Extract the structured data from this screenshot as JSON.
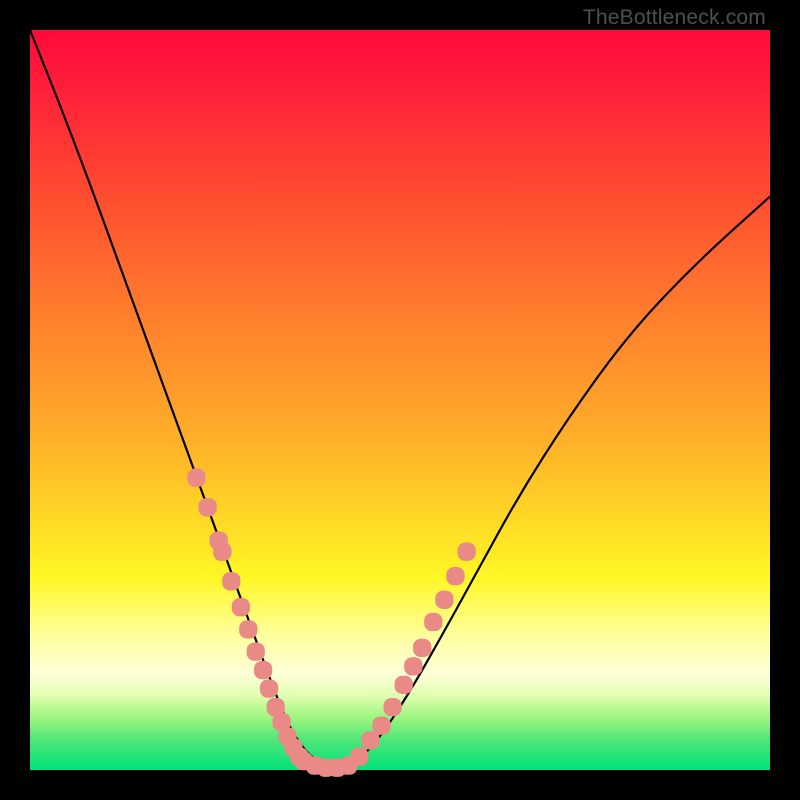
{
  "watermark": "TheBottleneck.com",
  "chart_data": {
    "type": "line",
    "title": "",
    "xlabel": "",
    "ylabel": "",
    "xlim": [
      0,
      1
    ],
    "ylim": [
      0,
      1
    ],
    "series": [
      {
        "name": "bottleneck-curve",
        "x": [
          0.0,
          0.04,
          0.08,
          0.12,
          0.16,
          0.2,
          0.22,
          0.24,
          0.26,
          0.28,
          0.3,
          0.32,
          0.335,
          0.35,
          0.365,
          0.38,
          0.395,
          0.41,
          0.44,
          0.47,
          0.51,
          0.55,
          0.6,
          0.66,
          0.73,
          0.81,
          0.9,
          1.0
        ],
        "y": [
          1.0,
          0.9,
          0.795,
          0.685,
          0.575,
          0.465,
          0.41,
          0.355,
          0.3,
          0.245,
          0.19,
          0.135,
          0.095,
          0.06,
          0.035,
          0.018,
          0.008,
          0.003,
          0.01,
          0.04,
          0.1,
          0.17,
          0.26,
          0.37,
          0.48,
          0.59,
          0.685,
          0.775
        ]
      },
      {
        "name": "marker-cluster-left",
        "x": [
          0.225,
          0.24,
          0.255,
          0.26,
          0.272,
          0.285,
          0.295,
          0.305,
          0.315,
          0.323,
          0.332,
          0.34,
          0.348,
          0.356,
          0.364
        ],
        "y": [
          0.395,
          0.355,
          0.31,
          0.295,
          0.255,
          0.22,
          0.19,
          0.16,
          0.135,
          0.11,
          0.085,
          0.065,
          0.045,
          0.03,
          0.018
        ]
      },
      {
        "name": "marker-cluster-bottom",
        "x": [
          0.37,
          0.385,
          0.4,
          0.415,
          0.43,
          0.445,
          0.46
        ],
        "y": [
          0.012,
          0.006,
          0.003,
          0.003,
          0.006,
          0.018,
          0.04
        ]
      },
      {
        "name": "marker-cluster-right",
        "x": [
          0.475,
          0.49,
          0.505,
          0.518,
          0.53,
          0.545,
          0.56,
          0.575,
          0.59
        ],
        "y": [
          0.06,
          0.085,
          0.115,
          0.14,
          0.165,
          0.2,
          0.23,
          0.262,
          0.295
        ]
      }
    ],
    "curve_color": "#000000",
    "marker_color": "#e98a86",
    "marker_radius_frac": 0.013
  }
}
